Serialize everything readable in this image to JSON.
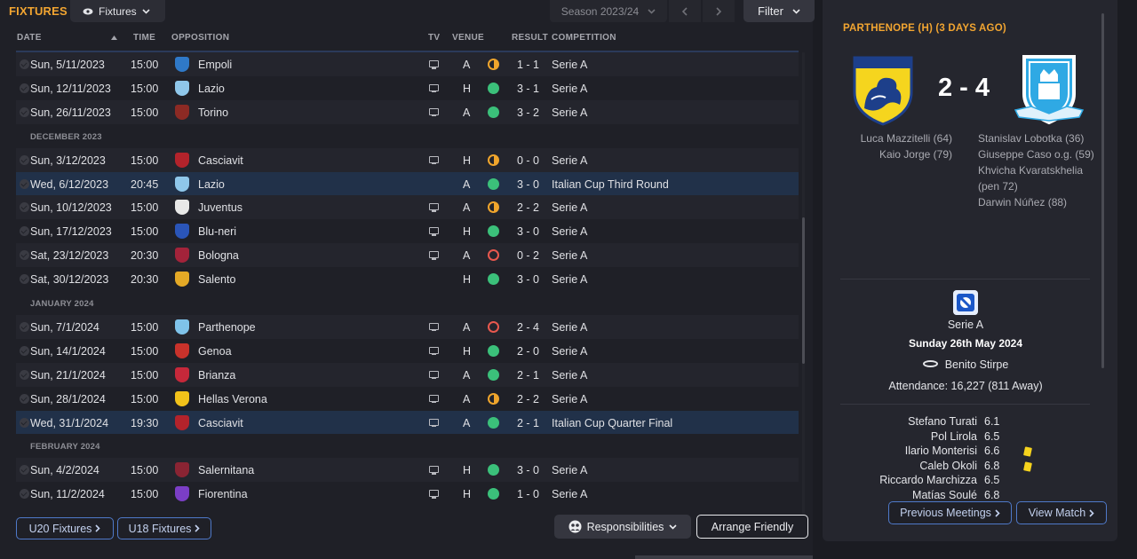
{
  "header": {
    "title": "FIXTURES",
    "fixtures_dropdown": "Fixtures",
    "season": "Season 2023/24",
    "filter": "Filter"
  },
  "columns": {
    "date": "DATE",
    "time": "TIME",
    "opposition": "OPPOSITION",
    "tv": "TV",
    "venue": "VENUE",
    "result": "RESULT",
    "competition": "COMPETITION"
  },
  "rows": [
    {
      "type": "match",
      "date": "Sun, 5/11/2023",
      "time": "15:00",
      "opp": "Empoli",
      "crest": "#2f79c8",
      "tv": true,
      "venue": "A",
      "outcome": "D",
      "result": "1 - 1",
      "comp": "Serie A"
    },
    {
      "type": "match",
      "date": "Sun, 12/11/2023",
      "time": "15:00",
      "opp": "Lazio",
      "crest": "#8fc7ea",
      "tv": true,
      "venue": "H",
      "outcome": "W",
      "result": "3 - 1",
      "comp": "Serie A"
    },
    {
      "type": "match",
      "date": "Sun, 26/11/2023",
      "time": "15:00",
      "opp": "Torino",
      "crest": "#8c2a24",
      "tv": true,
      "venue": "A",
      "outcome": "W",
      "result": "3 - 2",
      "comp": "Serie A"
    },
    {
      "type": "month",
      "label": "DECEMBER 2023"
    },
    {
      "type": "match",
      "date": "Sun, 3/12/2023",
      "time": "15:00",
      "opp": "Casciavit",
      "crest": "#b3232b",
      "tv": true,
      "venue": "H",
      "outcome": "D",
      "result": "0 - 0",
      "comp": "Serie A"
    },
    {
      "type": "match",
      "date": "Wed, 6/12/2023",
      "time": "20:45",
      "opp": "Lazio",
      "crest": "#8fc7ea",
      "tv": false,
      "venue": "A",
      "outcome": "W",
      "result": "3 - 0",
      "comp": "Italian Cup Third Round",
      "highlight": true
    },
    {
      "type": "match",
      "date": "Sun, 10/12/2023",
      "time": "15:00",
      "opp": "Juventus",
      "crest": "#e8e8e8",
      "tv": true,
      "venue": "A",
      "outcome": "D",
      "result": "2 - 2",
      "comp": "Serie A"
    },
    {
      "type": "match",
      "date": "Sun, 17/12/2023",
      "time": "15:00",
      "opp": "Blu-neri",
      "crest": "#2a55b8",
      "tv": true,
      "venue": "H",
      "outcome": "W",
      "result": "3 - 0",
      "comp": "Serie A"
    },
    {
      "type": "match",
      "date": "Sat, 23/12/2023",
      "time": "20:30",
      "opp": "Bologna",
      "crest": "#a3233a",
      "tv": true,
      "venue": "A",
      "outcome": "L",
      "result": "0 - 2",
      "comp": "Serie A"
    },
    {
      "type": "match",
      "date": "Sat, 30/12/2023",
      "time": "20:30",
      "opp": "Salento",
      "crest": "#e4a926",
      "tv": false,
      "venue": "H",
      "outcome": "W",
      "result": "3 - 0",
      "comp": "Serie A"
    },
    {
      "type": "month",
      "label": "JANUARY 2024"
    },
    {
      "type": "match",
      "date": "Sun, 7/1/2024",
      "time": "15:00",
      "opp": "Parthenope",
      "crest": "#7fc3ea",
      "tv": true,
      "venue": "A",
      "outcome": "L",
      "result": "2 - 4",
      "comp": "Serie A"
    },
    {
      "type": "match",
      "date": "Sun, 14/1/2024",
      "time": "15:00",
      "opp": "Genoa",
      "crest": "#c8322b",
      "tv": true,
      "venue": "H",
      "outcome": "W",
      "result": "2 - 0",
      "comp": "Serie A"
    },
    {
      "type": "match",
      "date": "Sun, 21/1/2024",
      "time": "15:00",
      "opp": "Brianza",
      "crest": "#c6283a",
      "tv": true,
      "venue": "A",
      "outcome": "W",
      "result": "2 - 1",
      "comp": "Serie A"
    },
    {
      "type": "match",
      "date": "Sun, 28/1/2024",
      "time": "15:00",
      "opp": "Hellas Verona",
      "crest": "#f2c21a",
      "tv": true,
      "venue": "A",
      "outcome": "D",
      "result": "2 - 2",
      "comp": "Serie A"
    },
    {
      "type": "match",
      "date": "Wed, 31/1/2024",
      "time": "19:30",
      "opp": "Casciavit",
      "crest": "#b3232b",
      "tv": true,
      "venue": "A",
      "outcome": "W",
      "result": "2 - 1",
      "comp": "Italian Cup Quarter Final",
      "highlight": true
    },
    {
      "type": "month",
      "label": "FEBRUARY 2024"
    },
    {
      "type": "match",
      "date": "Sun, 4/2/2024",
      "time": "15:00",
      "opp": "Salernitana",
      "crest": "#8a2433",
      "tv": true,
      "venue": "H",
      "outcome": "W",
      "result": "3 - 0",
      "comp": "Serie A"
    },
    {
      "type": "match",
      "date": "Sun, 11/2/2024",
      "time": "15:00",
      "opp": "Fiorentina",
      "crest": "#7b3ec6",
      "tv": true,
      "venue": "H",
      "outcome": "W",
      "result": "1 - 0",
      "comp": "Serie A"
    }
  ],
  "footer": {
    "u20": "U20 Fixtures",
    "u18": "U18 Fixtures",
    "responsibilities": "Responsibilities",
    "arrange": "Arrange Friendly"
  },
  "match_panel": {
    "title": "PARTHENOPE (H) (3 DAYS AGO)",
    "score": "2 - 4",
    "home_badge_text": "FROSINONE CALCIO",
    "home_scorers": [
      "Luca Mazzitelli (64)",
      "Kaio Jorge (79)"
    ],
    "away_scorers": [
      "Stanislav Lobotka (36)",
      "Giuseppe Caso o.g. (59)",
      "Khvicha Kvaratskhelia (pen 72)",
      "Darwin Núñez (88)"
    ],
    "competition": "Serie A",
    "date": "Sunday 26th May 2024",
    "stadium": "Benito Stirpe",
    "attendance": "Attendance: 16,227 (811 Away)",
    "ratings": [
      {
        "name": "Stefano Turati",
        "rating": "6.1",
        "card": false
      },
      {
        "name": "Pol Lirola",
        "rating": "6.5",
        "card": false
      },
      {
        "name": "Ilario Monterisi",
        "rating": "6.6",
        "card": true
      },
      {
        "name": "Caleb Okoli",
        "rating": "6.8",
        "card": true
      },
      {
        "name": "Riccardo Marchizza",
        "rating": "6.5",
        "card": false
      },
      {
        "name": "Matías Soulé",
        "rating": "6.8",
        "card": false
      }
    ],
    "prev_button": "Previous Meetings",
    "view_button": "View Match"
  },
  "colors": {
    "accent": "#f2a531",
    "win": "#3bc07a",
    "draw": "#f0a52c",
    "loss": "#e8584e",
    "highlight_row": "#213149"
  }
}
